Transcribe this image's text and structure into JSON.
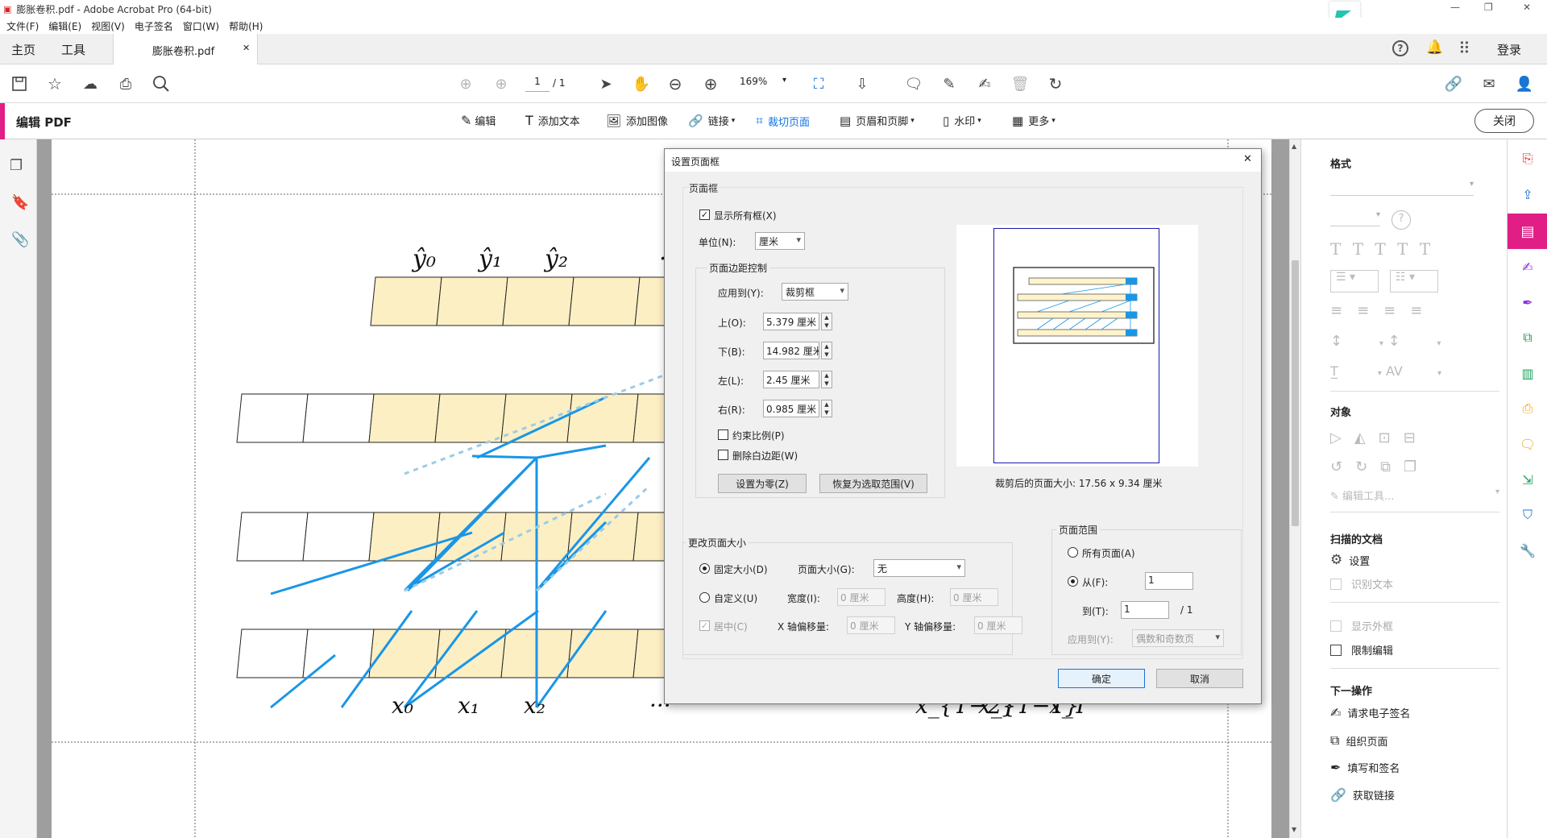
{
  "window": {
    "title": "膨胀卷积.pdf - Adobe Acrobat Pro (64-bit)",
    "minimize": "—",
    "restore": "❐",
    "close": "✕"
  },
  "menu": [
    "文件(F)",
    "编辑(E)",
    "视图(V)",
    "电子签名",
    "窗口(W)",
    "帮助(H)"
  ],
  "tabs": {
    "home": "主页",
    "tools": "工具",
    "doc": "膨胀卷积.pdf",
    "doc_close": "✕",
    "signin": "登录"
  },
  "toolbar": {
    "page_current": "1",
    "page_total": "/ 1",
    "zoom": "169%"
  },
  "editbar": {
    "title": "编辑 PDF",
    "items": [
      {
        "label": "编辑",
        "icon": "edit-icon"
      },
      {
        "label": "添加文本",
        "icon": "text-icon"
      },
      {
        "label": "添加图像",
        "icon": "image-icon"
      },
      {
        "label": "链接",
        "icon": "link-icon"
      },
      {
        "label": "裁切页面",
        "icon": "crop-icon"
      },
      {
        "label": "页眉和页脚",
        "icon": "header-footer-icon"
      },
      {
        "label": "水印",
        "icon": "watermark-icon"
      },
      {
        "label": "更多",
        "icon": "more-icon"
      }
    ],
    "close": "关闭"
  },
  "figure": {
    "top_labels": [
      "ŷ₀",
      "ŷ₁",
      "ŷ₂",
      "·"
    ],
    "bottom_labels": [
      "x₀",
      "x₁",
      "x₂",
      "···",
      "x_{T−2}",
      "x_{T−1}",
      "x_T"
    ],
    "cell_color": "#fcefc4",
    "line_color": "#1a96e6",
    "dashed_color": "#9bcbe8"
  },
  "dialog": {
    "title": "设置页面框",
    "close": "✕",
    "pagebox": {
      "group": "页面框",
      "show_all": "显示所有框(X)",
      "show_all_checked": true,
      "unit_label": "单位(N):",
      "unit_value": "厘米",
      "margins_group": "页面边距控制",
      "apply_label": "应用到(Y):",
      "apply_value": "裁剪框",
      "top_label": "上(O):",
      "top_value": "5.379 厘米",
      "bottom_label": "下(B):",
      "bottom_value": "14.982 厘米",
      "left_label": "左(L):",
      "left_value": "2.45 厘米",
      "right_label": "右(R):",
      "right_value": "0.985 厘米",
      "constrain": "约束比例(P)",
      "remove_white": "删除白边距(W)",
      "set_zero": "设置为零(Z)",
      "revert": "恢复为选取范围(V)",
      "preview_caption": "裁剪后的页面大小: 17.56 x 9.34 厘米"
    },
    "resize": {
      "group": "更改页面大小",
      "fixed": "固定大小(D)",
      "page_size_label": "页面大小(G):",
      "page_size_value": "无",
      "custom": "自定义(U)",
      "width_label": "宽度(I):",
      "width_value": "0 厘米",
      "height_label": "高度(H):",
      "height_value": "0 厘米",
      "center": "居中(C)",
      "xoff_label": "X 轴偏移量:",
      "xoff_value": "0 厘米",
      "yoff_label": "Y 轴偏移量:",
      "yoff_value": "0 厘米"
    },
    "range": {
      "group": "页面范围",
      "all": "所有页面(A)",
      "from_label": "从(F):",
      "from_value": "1",
      "to_label": "到(T):",
      "to_value": "1",
      "to_total": "/ 1",
      "apply_label": "应用到(Y):",
      "apply_value": "偶数和奇数页"
    },
    "ok": "确定",
    "cancel": "取消"
  },
  "rightpanel": {
    "format": "格式",
    "objects": "对象",
    "edit_tools": "编辑工具...",
    "scanned": "扫描的文档",
    "settings": "设置",
    "ocr": "识别文本",
    "show_outline": "显示外框",
    "restrict_edit": "限制编辑",
    "next": "下一操作",
    "actions": [
      "请求电子签名",
      "组织页面",
      "填写和签名",
      "获取链接"
    ]
  },
  "colors": {
    "accent_pink": "#e01e85",
    "blue": "#1473e6"
  }
}
